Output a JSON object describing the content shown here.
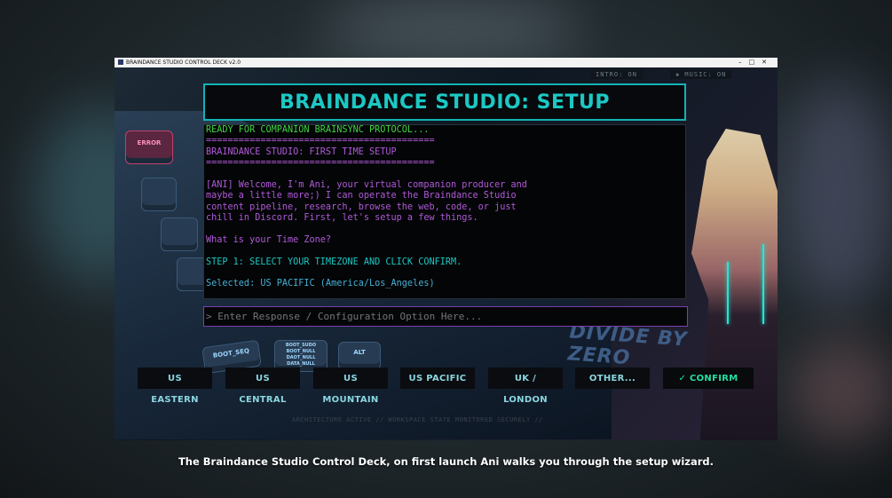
{
  "window": {
    "title": "BRAINDANCE STUDIO CONTROL DECK v2.0",
    "controls": [
      "–",
      "□",
      "✕"
    ]
  },
  "status": {
    "intro": "INTRO: ON",
    "music": "◈ MUSIC: ON"
  },
  "artwork": {
    "keys": [
      "ERROR",
      "BOOT_SEQ",
      "BOOT_SUDO BOOT_NULL DAOT_NULL DATA_NULL",
      "ALT"
    ],
    "keyboard_text": "DIVIDE BY ZERO"
  },
  "header": {
    "title": "BRAINDANCE STUDIO: SETUP"
  },
  "console": {
    "lines": [
      {
        "text": "READY FOR COMPANION BRAINSYNC PROTOCOL...",
        "color": "green"
      },
      {
        "text": "==========================================",
        "color": "violet"
      },
      {
        "text": "BRAINDANCE STUDIO: FIRST TIME SETUP",
        "color": "violet"
      },
      {
        "text": "==========================================",
        "color": "violet"
      },
      {
        "text": "",
        "color": "violet"
      },
      {
        "text": "[ANI] Welcome, I'm Ani, your virtual companion producer and",
        "color": "violet"
      },
      {
        "text": "maybe a little more;) I can operate the Braindance Studio",
        "color": "violet"
      },
      {
        "text": "content pipeline, research, browse the web, code, or just",
        "color": "violet"
      },
      {
        "text": "chill in Discord. First, let's setup a few things.",
        "color": "violet"
      },
      {
        "text": "",
        "color": "violet"
      },
      {
        "text": "What is your Time Zone?",
        "color": "violet"
      },
      {
        "text": "",
        "color": "violet"
      },
      {
        "text": "STEP 1: SELECT YOUR TIMEZONE AND CLICK CONFIRM.",
        "color": "cyan"
      },
      {
        "text": "",
        "color": "cyan"
      },
      {
        "text": "Selected: US PACIFIC (America/Los_Angeles)",
        "color": "blue"
      }
    ]
  },
  "input": {
    "placeholder": "> Enter Response / Configuration Option Here..."
  },
  "buttons": [
    {
      "label": "US EASTERN",
      "name": "us-eastern-button"
    },
    {
      "label": "US CENTRAL",
      "name": "us-central-button"
    },
    {
      "label": "US MOUNTAIN",
      "name": "us-mountain-button"
    },
    {
      "label": "US PACIFIC",
      "name": "us-pacific-button"
    },
    {
      "label": "UK / LONDON",
      "name": "uk-london-button"
    },
    {
      "label": "OTHER...",
      "name": "other-button"
    },
    {
      "label": "✓ CONFIRM",
      "name": "confirm-button"
    }
  ],
  "footer_note": "ARCHITECTURE ACTIVE // WORKSPACE STATE MONITORED SECURELY //",
  "caption": "The Braindance Studio Control Deck, on first launch Ani walks you through the setup wizard."
}
